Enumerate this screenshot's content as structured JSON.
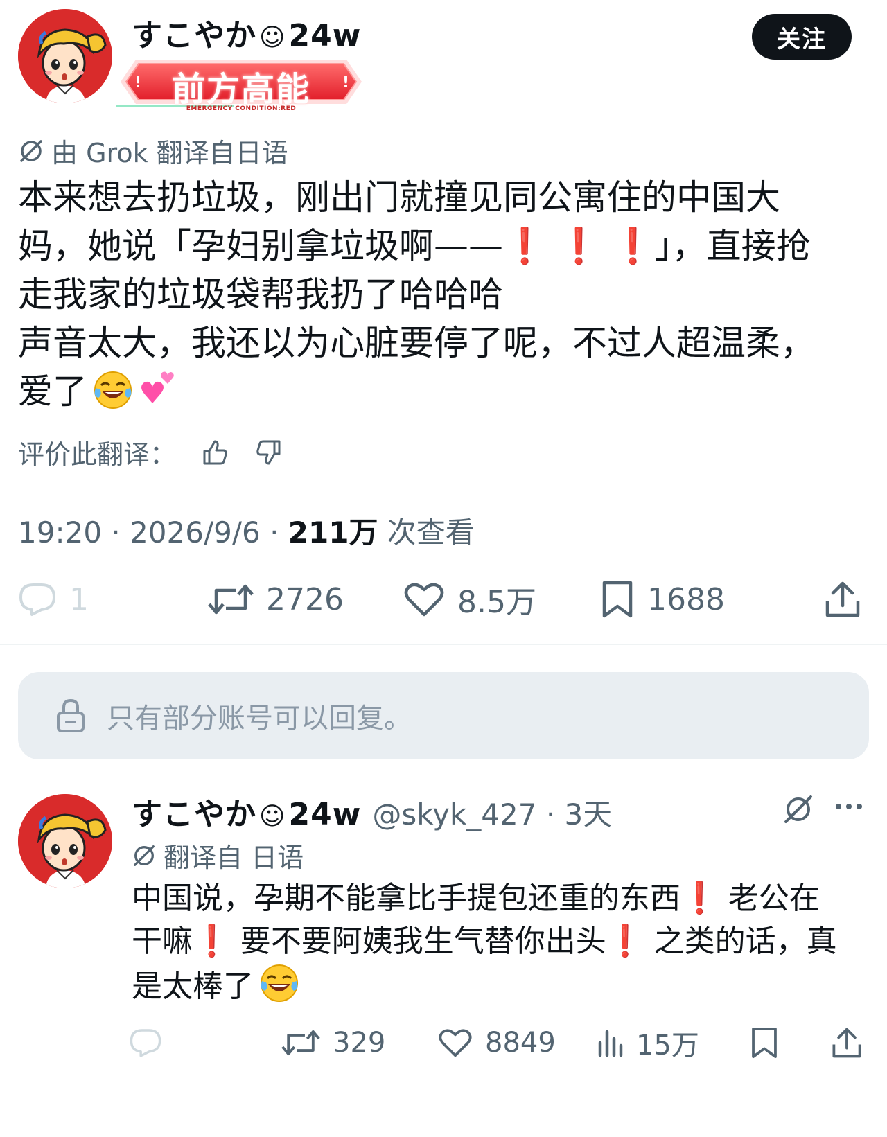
{
  "main_tweet": {
    "author": {
      "name": "すこやか",
      "emoji": "☺",
      "suffix": "24w"
    },
    "badge": {
      "text": "前方高能",
      "subtext": "EMERGENCY CONDITION:RED"
    },
    "follow_label": "关注",
    "translated_by": "由 Grok 翻译自日语",
    "text_lines": [
      "本来想去扔垃圾，刚出门就撞见同公寓住的中国大",
      "妈，她说「孕妇别拿垃圾啊——",
      "」，直接抢",
      "走我家的垃圾袋帮我扔了哈哈哈",
      "声音太大，我还以为心脏要停了呢，不过人超温柔，",
      "爱了"
    ],
    "exclaim": "❗",
    "rate_label": "评价此翻译：",
    "time": "19:20 · 2026/9/6 · ",
    "views": "211万",
    "views_label": " 次查看",
    "stats": {
      "replies": "1",
      "retweets": "2726",
      "likes": "8.5万",
      "bookmarks": "1688"
    }
  },
  "restriction_notice": "只有部分账号可以回复。",
  "reply": {
    "author": {
      "name": "すこやか",
      "emoji": "☺",
      "suffix": "24w"
    },
    "handle": "@skyk_427 · 3天",
    "translated": "翻译自 日语",
    "text_segments": [
      "中国说，孕期不能拿比手提包还重的东西",
      " 老公在",
      "干嘛",
      " 要不要阿姨我生气替你出头",
      " 之类的话，真",
      "是太棒了"
    ],
    "stats": {
      "retweets": "329",
      "likes": "8849",
      "views": "15万"
    }
  },
  "colors": {
    "accent_red": "#e0232e",
    "muted": "#536471",
    "follow_bg": "#0f1419",
    "notice_bg": "#e9eef2"
  }
}
